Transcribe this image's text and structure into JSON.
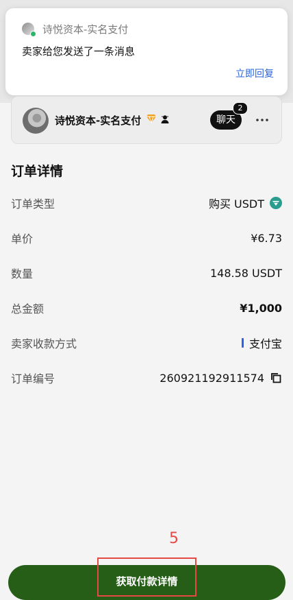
{
  "notification": {
    "app_name": "诗悦资本-实名支付",
    "message": "卖家给您发送了一条消息",
    "reply_label": "立即回复"
  },
  "seller": {
    "name": "诗悦资本-实名支付",
    "chat_label": "聊天",
    "unread_count": "2"
  },
  "order_details": {
    "title": "订单详情",
    "rows": [
      {
        "label": "订单类型",
        "value": "购买 USDT"
      },
      {
        "label": "单价",
        "value": "¥6.73"
      },
      {
        "label": "数量",
        "value": "148.58 USDT"
      },
      {
        "label": "总金额",
        "value": "¥1,000"
      },
      {
        "label": "卖家收款方式",
        "value": "支付宝"
      },
      {
        "label": "订单编号",
        "value": "260921192911574"
      }
    ]
  },
  "footer": {
    "step_number": "5",
    "cta_label": "获取付款详情"
  },
  "colors": {
    "accent": "#265e18",
    "link": "#2c63d8",
    "highlight": "#e44a43"
  },
  "icons": {
    "notification": "app-icon",
    "verified": "verified-icon",
    "user_badge": "user-badge-icon",
    "more": "more-icon",
    "usdt": "usdt-icon",
    "copy": "copy-icon"
  }
}
